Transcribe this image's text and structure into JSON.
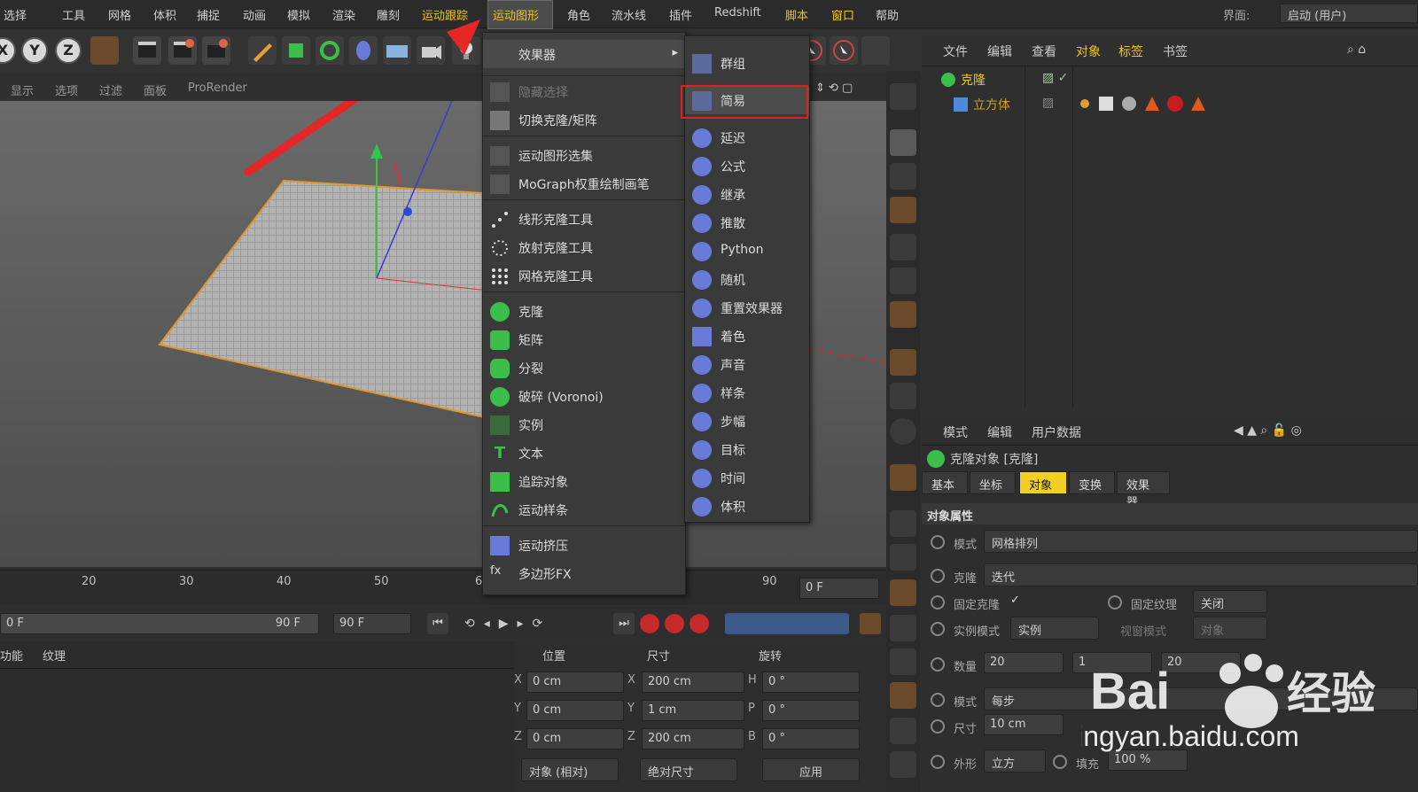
{
  "menubar": {
    "items": [
      "选择",
      "工具",
      "网格",
      "体积",
      "捕捉",
      "动画",
      "模拟",
      "渲染",
      "雕刻",
      "运动跟踪",
      "运动图形",
      "角色",
      "流水线",
      "插件",
      "Redshift",
      "脚本",
      "窗口",
      "帮助"
    ],
    "interface_label": "界面:",
    "interface_value": "启动 (用户)"
  },
  "toolbar": {
    "axes": [
      "X",
      "Y",
      "Z"
    ]
  },
  "viewport_menu": [
    "显示",
    "选项",
    "过滤",
    "面板",
    "ProRender"
  ],
  "mograph_menu": {
    "effectors_label": "效果器",
    "items": [
      "隐藏选择",
      "切换克隆/矩阵",
      "运动图形选集",
      "MoGraph权重绘制画笔",
      "线形克隆工具",
      "放射克隆工具",
      "网格克隆工具",
      "克隆",
      "矩阵",
      "分裂",
      "破碎 (Voronoi)",
      "实例",
      "文本",
      "追踪对象",
      "运动样条",
      "运动挤压",
      "多边形FX"
    ]
  },
  "effectors_submenu": {
    "items": [
      "群组",
      "简易",
      "延迟",
      "公式",
      "继承",
      "推散",
      "Python",
      "随机",
      "重置效果器",
      "着色",
      "声音",
      "样条",
      "步幅",
      "目标",
      "时间",
      "体积"
    ],
    "highlighted": "简易"
  },
  "timeline": {
    "ticks": [
      "20",
      "30",
      "40",
      "50",
      "6",
      "90"
    ],
    "frame_field": "0 F",
    "range_start": "0 F",
    "range_end": "90 F",
    "end_field": "90 F"
  },
  "bottom_tabs": [
    "功能",
    "纹理"
  ],
  "coords": {
    "headers": [
      "位置",
      "尺寸",
      "旋转"
    ],
    "rows": [
      {
        "axis": "X",
        "pos": "0 cm",
        "size_axis": "X",
        "size": "200 cm",
        "rot_axis": "H",
        "rot": "0 °"
      },
      {
        "axis": "Y",
        "pos": "0 cm",
        "size_axis": "Y",
        "size": "1 cm",
        "rot_axis": "P",
        "rot": "0 °"
      },
      {
        "axis": "Z",
        "pos": "0 cm",
        "size_axis": "Z",
        "size": "200 cm",
        "rot_axis": "B",
        "rot": "0 °"
      }
    ],
    "mode1": "对象 (相对)",
    "mode2": "绝对尺寸",
    "apply": "应用"
  },
  "object_manager": {
    "menu": [
      "文件",
      "编辑",
      "查看",
      "对象",
      "标签",
      "书签"
    ],
    "objects": [
      {
        "name": "克隆"
      },
      {
        "name": "立方体"
      }
    ]
  },
  "attributes": {
    "menu": [
      "模式",
      "编辑",
      "用户数据"
    ],
    "title": "克隆对象 [克隆]",
    "tabs": [
      "基本",
      "坐标",
      "对象",
      "变换",
      "效果器"
    ],
    "active_tab": "对象",
    "section": "对象属性",
    "rows": {
      "mode_label": "模式",
      "mode_value": "网格排列",
      "clone_label": "克隆",
      "clone_value": "迭代",
      "fixclone_label": "固定克隆",
      "fixclone_check": "✓",
      "fixtex_label": "固定纹理",
      "fixtex_value": "关闭",
      "instmode_label": "实例模式",
      "instmode_value": "实例",
      "viewport_label": "视窗模式",
      "viewport_value": "对象",
      "count_label": "数量",
      "count_value": "20",
      "count_value2": "1",
      "count_value3": "20",
      "mode2_label": "模式",
      "mode2_value": "每步",
      "size_label": "尺寸",
      "size_value": "10 cm",
      "shape_label": "外形",
      "shape_value": "立方",
      "fill_label": "填充",
      "fill_value": "100 %"
    }
  },
  "watermark": {
    "brand": "Bai",
    "brand2": "经验",
    "url": "jingyan.baidu.com"
  },
  "colors": {
    "accent": "#f0c419",
    "highlight_border": "#e02020",
    "arrow": "#e52626"
  }
}
